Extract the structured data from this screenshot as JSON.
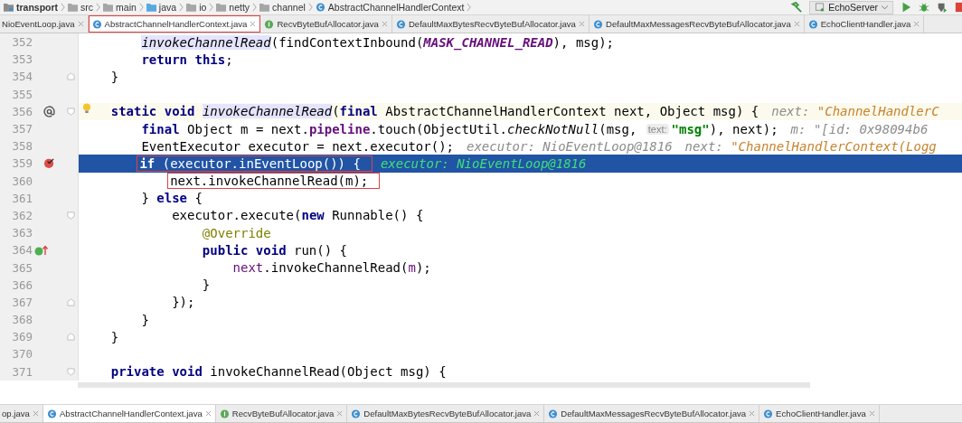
{
  "breadcrumbs": [
    {
      "label": "transport",
      "kind": "module"
    },
    {
      "label": "src",
      "kind": "folder"
    },
    {
      "label": "main",
      "kind": "folder"
    },
    {
      "label": "java",
      "kind": "source"
    },
    {
      "label": "io",
      "kind": "package"
    },
    {
      "label": "netty",
      "kind": "package"
    },
    {
      "label": "channel",
      "kind": "package"
    },
    {
      "label": "AbstractChannelHandlerContext",
      "kind": "class"
    }
  ],
  "toolbar": {
    "run_config": "EchoServer"
  },
  "tabs": [
    {
      "label": "NioEventLoop.java",
      "kind": "none",
      "selected": false,
      "marked": false
    },
    {
      "label": "AbstractChannelHandlerContext.java",
      "kind": "class",
      "selected": true,
      "marked": true
    },
    {
      "label": "RecvByteBufAllocator.java",
      "kind": "interface",
      "selected": false,
      "marked": false
    },
    {
      "label": "DefaultMaxBytesRecvByteBufAllocator.java",
      "kind": "class",
      "selected": false,
      "marked": false
    },
    {
      "label": "DefaultMaxMessagesRecvByteBufAllocator.java",
      "kind": "class",
      "selected": false,
      "marked": false
    },
    {
      "label": "EchoClientHandler.java",
      "kind": "class",
      "selected": false,
      "marked": false
    }
  ],
  "lines": [
    {
      "number": "352",
      "tokens": [
        {
          "kind": "usage",
          "text": "        invokeChannelRead"
        },
        {
          "kind": "plain",
          "text": "(findContextInbound("
        },
        {
          "kind": "constant",
          "text": "MASK_CHANNEL_READ"
        },
        {
          "kind": "plain",
          "text": "), msg);"
        }
      ]
    },
    {
      "number": "353",
      "tokens": [
        {
          "kind": "keyword",
          "text": "        return"
        },
        {
          "kind": "keyword",
          "text": " this"
        },
        {
          "kind": "plain",
          "text": ";"
        }
      ]
    },
    {
      "number": "354",
      "fold_end": true,
      "tokens": [
        {
          "kind": "plain",
          "text": "    }"
        }
      ]
    },
    {
      "number": "355"
    },
    {
      "number": "356",
      "caret_line": true,
      "override_marker": true,
      "bulb": true,
      "fold_start": true,
      "tokens": [
        {
          "kind": "keyword",
          "text": "    static void"
        },
        {
          "kind": "usage",
          "text": " invokeChannelRead"
        },
        {
          "kind": "plain",
          "text": "("
        },
        {
          "kind": "keyword",
          "text": "final"
        },
        {
          "kind": "plain",
          "text": " AbstractChannelHandlerContext next, Object msg) {"
        },
        {
          "kind": "hint",
          "text": "next: "
        },
        {
          "kind": "hint-value",
          "text": "\"ChannelHandlerC"
        }
      ]
    },
    {
      "number": "357",
      "tokens": [
        {
          "kind": "keyword",
          "text": "        final"
        },
        {
          "kind": "plain",
          "text": " Object m = next."
        },
        {
          "kind": "field",
          "text": "pipeline"
        },
        {
          "kind": "plain",
          "text": ".touch(ObjectUtil."
        },
        {
          "kind": "static-call",
          "text": "checkNotNull"
        },
        {
          "kind": "plain",
          "text": "(msg, "
        },
        {
          "kind": "param-hint",
          "text": "text:"
        },
        {
          "kind": "string",
          "text": "\"msg\""
        },
        {
          "kind": "plain",
          "text": "), next);"
        },
        {
          "kind": "hint",
          "text": "m: \"[id: 0x98094b6"
        }
      ]
    },
    {
      "number": "358",
      "tokens": [
        {
          "kind": "plain",
          "text": "        EventExecutor executor = next.executor();"
        },
        {
          "kind": "hint",
          "text": "executor: NioEventLoop@1816"
        },
        {
          "kind": "hint",
          "text": "next: "
        },
        {
          "kind": "hint-value",
          "text": "\"ChannelHandlerContext(Logg"
        }
      ]
    },
    {
      "number": "359",
      "execution_point": true,
      "breakpoint": true,
      "tokens": [
        {
          "kind": "box",
          "tokens": [
            {
              "kind": "keyword",
              "text": "        if"
            },
            {
              "kind": "plain",
              "text": " (executor.inEventLoop()) {"
            }
          ]
        },
        {
          "kind": "exec-hint",
          "text": "executor: NioEventLoop@1816"
        }
      ]
    },
    {
      "number": "360",
      "tokens": [
        {
          "kind": "box",
          "tokens": [
            {
              "kind": "plain",
              "text": "            next.invokeChannelRead(m);"
            }
          ]
        }
      ]
    },
    {
      "number": "361",
      "tokens": [
        {
          "kind": "plain",
          "text": "        }"
        },
        {
          "kind": "keyword",
          "text": " else"
        },
        {
          "kind": "plain",
          "text": " {"
        }
      ]
    },
    {
      "number": "362",
      "fold_start": true,
      "tokens": [
        {
          "kind": "plain",
          "text": "            executor.execute("
        },
        {
          "kind": "keyword",
          "text": "new"
        },
        {
          "kind": "plain",
          "text": " Runnable() {"
        }
      ]
    },
    {
      "number": "363",
      "tokens": [
        {
          "kind": "annotation",
          "text": "                @Override"
        }
      ]
    },
    {
      "number": "364",
      "implements_marker": true,
      "tokens": [
        {
          "kind": "keyword",
          "text": "                public void"
        },
        {
          "kind": "plain",
          "text": " run() {"
        }
      ]
    },
    {
      "number": "365",
      "tokens": [
        {
          "kind": "captured",
          "text": "                    next"
        },
        {
          "kind": "plain",
          "text": ".invokeChannelRead("
        },
        {
          "kind": "captured",
          "text": "m"
        },
        {
          "kind": "plain",
          "text": ");"
        }
      ]
    },
    {
      "number": "366",
      "tokens": [
        {
          "kind": "plain",
          "text": "                }"
        }
      ]
    },
    {
      "number": "367",
      "fold_end": true,
      "tokens": [
        {
          "kind": "plain",
          "text": "            });"
        }
      ]
    },
    {
      "number": "368",
      "tokens": [
        {
          "kind": "plain",
          "text": "        }"
        }
      ]
    },
    {
      "number": "369",
      "fold_end": true,
      "tokens": [
        {
          "kind": "plain",
          "text": "    }"
        }
      ]
    },
    {
      "number": "370"
    },
    {
      "number": "371",
      "fold_start": true,
      "tokens": [
        {
          "kind": "keyword",
          "text": "    private void"
        },
        {
          "kind": "plain",
          "text": " invokeChannelRead(Object msg) {"
        }
      ]
    }
  ],
  "bottom_tabs": [
    {
      "label": "op.java",
      "kind": "none",
      "selected": false
    },
    {
      "label": "AbstractChannelHandlerContext.java",
      "kind": "class",
      "selected": true
    },
    {
      "label": "RecvByteBufAllocator.java",
      "kind": "interface",
      "selected": false
    },
    {
      "label": "DefaultMaxBytesRecvByteBufAllocator.java",
      "kind": "class",
      "selected": false
    },
    {
      "label": "DefaultMaxMessagesRecvByteBufAllocator.java",
      "kind": "class",
      "selected": false
    },
    {
      "label": "EchoClientHandler.java",
      "kind": "class",
      "selected": false
    }
  ]
}
